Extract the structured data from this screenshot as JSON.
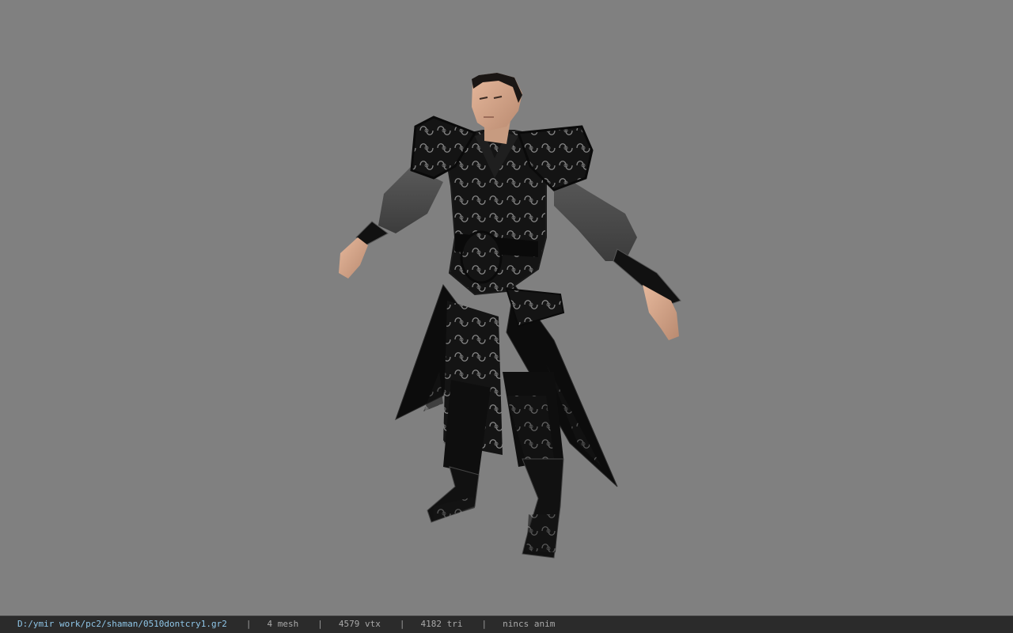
{
  "viewer": {
    "background_color": "#808080",
    "model_name": "shaman character model",
    "statusbar": {
      "file_path": "D:/ymir work/pc2/shaman/0510dontcry1.gr2",
      "separator": "|",
      "mesh_count": "4 mesh",
      "vertex_count": "4579 vtx",
      "triangle_count": "4182 tri",
      "anim_status": "nincs anim"
    }
  }
}
